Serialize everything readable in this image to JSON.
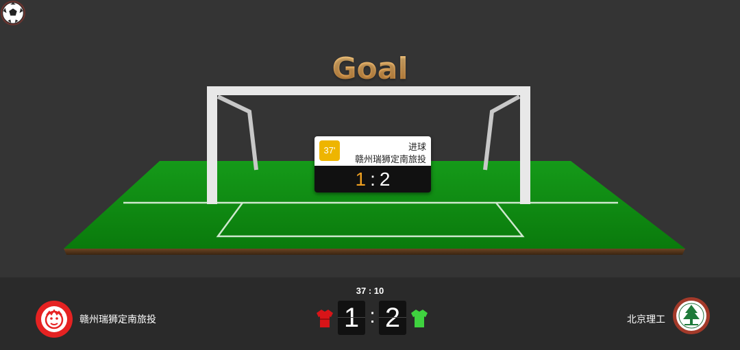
{
  "banner": {
    "title": "Goal"
  },
  "event": {
    "minute": "37'",
    "type": "进球",
    "team": "赣州瑞狮定南旅投",
    "score_home": "1",
    "score_sep": ":",
    "score_away": "2"
  },
  "scoreboard": {
    "clock": "37 : 10",
    "home": {
      "name": "赣州瑞狮定南旅投",
      "score": "1",
      "jersey_color": "#d81418",
      "logo_icon": "lion-club-logo"
    },
    "away": {
      "name": "北京理工",
      "score": "2",
      "jersey_color": "#3fd23f",
      "logo_icon": "university-seal-logo"
    },
    "separator": ":"
  },
  "colors": {
    "pitch": "#0d8a10",
    "background": "#343434",
    "bar": "#2a2a2a",
    "accent": "#eeb500"
  }
}
